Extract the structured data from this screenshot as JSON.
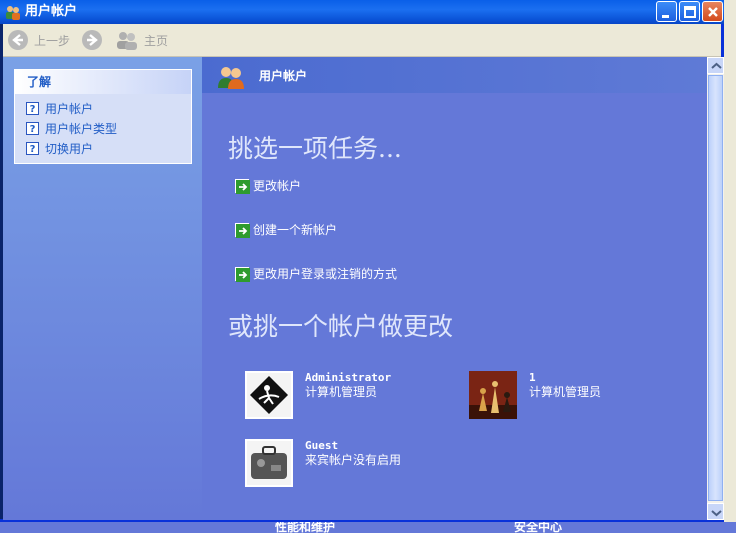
{
  "window": {
    "title": "用户帐户"
  },
  "toolbar": {
    "back_label": "上一步",
    "home_label": "主页"
  },
  "sidebar": {
    "header": "了解",
    "items": [
      {
        "label": "用户帐户"
      },
      {
        "label": "用户帐户类型"
      },
      {
        "label": "切换用户"
      }
    ]
  },
  "main": {
    "banner_title": "用户帐户",
    "pick_task": "挑选一项任务...",
    "tasks": [
      {
        "label": "更改帐户"
      },
      {
        "label": "创建一个新帐户"
      },
      {
        "label": "更改用户登录或注销的方式"
      }
    ],
    "pick_account": "或挑一个帐户做更改",
    "accounts": [
      {
        "name": "Administrator",
        "role": "计算机管理员"
      },
      {
        "name": "1",
        "role": "计算机管理员"
      },
      {
        "name": "Guest",
        "role": "来宾帐户没有启用"
      }
    ]
  },
  "background": {
    "left_text": "性能和维护",
    "right_text": "安全中心"
  }
}
